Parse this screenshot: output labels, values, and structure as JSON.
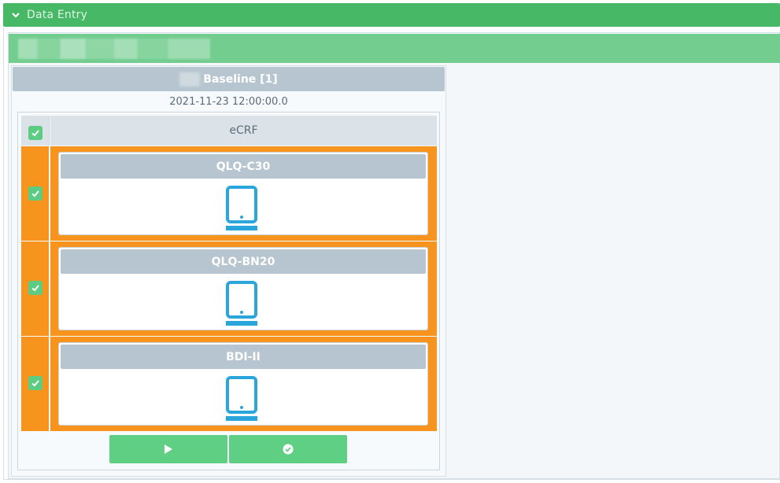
{
  "section": {
    "title": "Data Entry",
    "icon": "chevron-down-icon"
  },
  "visit": {
    "title": "Baseline [1]",
    "date": "2021-11-23 12:00:00.0"
  },
  "table": {
    "header_label": "eCRF",
    "header_checked": true
  },
  "forms": [
    {
      "name": "QLQ-C30",
      "checked": true,
      "icon": "tablet-icon"
    },
    {
      "name": "QLQ-BN20",
      "checked": true,
      "icon": "tablet-icon"
    },
    {
      "name": "BDI-II",
      "checked": true,
      "icon": "tablet-icon"
    }
  ],
  "actions": [
    {
      "icon": "play-icon"
    },
    {
      "icon": "check-circle-icon"
    }
  ],
  "colors": {
    "header_green": "#47b865",
    "patient_bar_green": "#72cd8f",
    "row_orange": "#f7941d",
    "checkbox_green": "#5ccc82",
    "tablet_blue": "#2aa6dc",
    "label_gray": "#b6c5cf"
  }
}
